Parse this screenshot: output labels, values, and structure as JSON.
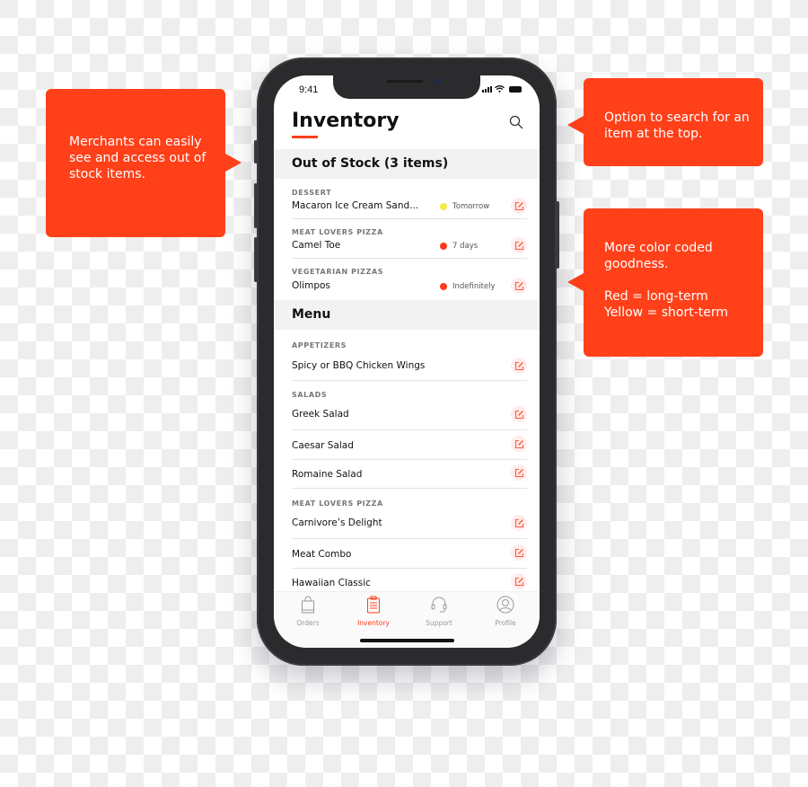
{
  "callouts": {
    "left": "Merchants can easily see and access out of stock items.",
    "top_right": "Option to search for an item at the top.",
    "mid_right": "More color coded goodness.\n\nRed = long-term\nYellow = short-term"
  },
  "colors": {
    "accent": "#ff4019",
    "status_yellow": "#f5e84a",
    "status_red": "#ff3b1a"
  },
  "status_bar": {
    "time": "9:41"
  },
  "header": {
    "title": "Inventory",
    "search_icon": "search-icon"
  },
  "out_of_stock": {
    "title": "Out of Stock (3 items)",
    "items": [
      {
        "category": "DESSERT",
        "name": "Macaron Ice Cream Sand...",
        "status": "Tomorrow",
        "status_color": "yellow"
      },
      {
        "category": "MEAT LOVERS PIZZA",
        "name": "Camel Toe",
        "status": "7 days",
        "status_color": "red"
      },
      {
        "category": "VEGETARIAN PIZZAS",
        "name": "Olimpos",
        "status": "Indefinitely",
        "status_color": "red"
      }
    ]
  },
  "menu": {
    "title": "Menu",
    "groups": [
      {
        "category": "APPETIZERS",
        "items": [
          "Spicy or BBQ Chicken Wings"
        ]
      },
      {
        "category": "SALADS",
        "items": [
          "Greek Salad",
          "Caesar Salad",
          "Romaine Salad"
        ]
      },
      {
        "category": "MEAT LOVERS PIZZA",
        "items": [
          "Carnivore’s Delight",
          "Meat Combo",
          "Hawaiian Classic"
        ]
      }
    ]
  },
  "tabbar": {
    "tabs": [
      {
        "label": "Orders",
        "icon": "shopping-bag-icon",
        "active": false
      },
      {
        "label": "Inventory",
        "icon": "clipboard-icon",
        "active": true
      },
      {
        "label": "Support",
        "icon": "headset-icon",
        "active": false
      },
      {
        "label": "Profile",
        "icon": "user-icon",
        "active": false
      }
    ]
  }
}
